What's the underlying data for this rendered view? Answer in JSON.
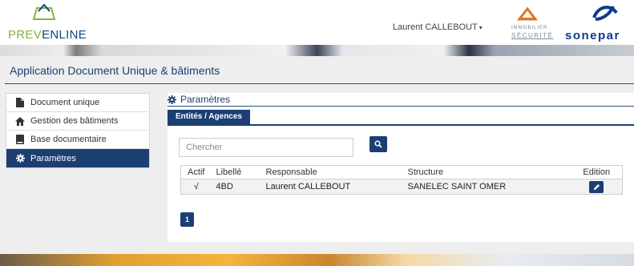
{
  "header": {
    "logo_text_pre": "PREV",
    "logo_text_rest": "ENLINE",
    "user_name": "Laurent CALLEBOUT",
    "partner_immobilier_line1": "IMMOBILIER",
    "partner_immobilier_line2": "SÉCURITÉ",
    "partner_sonepar": "sonepar"
  },
  "app": {
    "title": "Application Document Unique & bâtiments"
  },
  "sidebar": {
    "items": [
      {
        "label": "Document unique",
        "icon": "file-icon",
        "active": false
      },
      {
        "label": "Gestion des bâtiments",
        "icon": "home-icon",
        "active": false
      },
      {
        "label": "Base documentaire",
        "icon": "book-icon",
        "active": false
      },
      {
        "label": "Paramètres",
        "icon": "gear-icon",
        "active": true
      }
    ]
  },
  "main": {
    "section_title": "Paramètres",
    "tab_label": "Entités / Agences",
    "search_placeholder": "Chercher",
    "table": {
      "headers": [
        "Actif",
        "Libellé",
        "Responsable",
        "Structure",
        "Edition"
      ],
      "rows": [
        {
          "actif": "√",
          "libelle": "4BD",
          "responsable": "Laurent CALLEBOUT",
          "structure": "SANELEC SAINT OMER"
        }
      ]
    },
    "pagination_current": "1"
  },
  "colors": {
    "primary": "#1b3f73",
    "title": "#1a3f6e",
    "logo_green": "#8bb23a",
    "logo_blue": "#0a4a86",
    "sonepar_blue": "#0f3b8c",
    "immobilier_orange": "#e8731c"
  }
}
